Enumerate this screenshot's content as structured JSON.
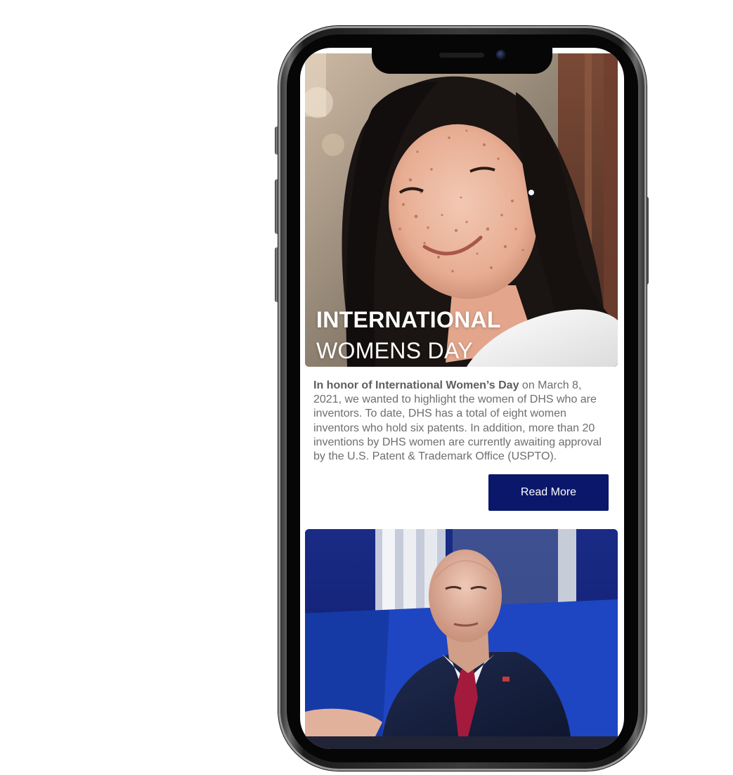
{
  "hero": {
    "title_line1": "INTERNATIONAL",
    "title_line2": "WOMENS DAY",
    "image_alt": "Smiling woman with freckles"
  },
  "intro": {
    "lead_bold": "In honor of International Women’s Day",
    "body": " on March 8, 2021, we wanted to highlight the women of DHS who are inventors. To date, DHS has a total of eight women inventors who hold six patents. In addition, more than 20 inventions by DHS women are currently awaiting approval by the U.S. Patent & Trademark Office (USPTO)."
  },
  "cta": {
    "read_more_label": "Read More"
  },
  "second_card": {
    "image_alt": "Man in suit with red tie"
  },
  "colors": {
    "button_bg": "#0a176a",
    "body_text": "#6e6e6e",
    "photo2_bg": "#1c2f8e"
  }
}
